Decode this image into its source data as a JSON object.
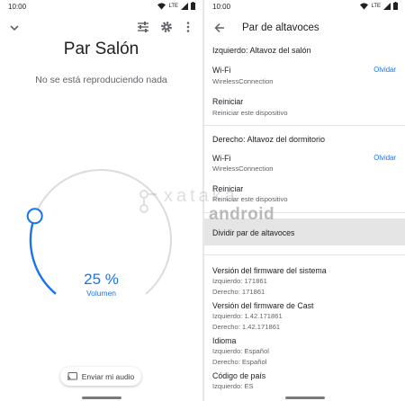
{
  "left": {
    "status": {
      "time": "10:00",
      "network": "LTE"
    },
    "title": "Par Salón",
    "subtitle": "No se está reproduciendo nada",
    "icons": [
      "chevron-down-icon",
      "tune-icon",
      "gear-icon",
      "more-vert-icon"
    ],
    "volume": {
      "percent_label": "25 %",
      "label": "Volumen",
      "level": 0.25
    },
    "cast_button": {
      "label": "Enviar mi audio",
      "icon": "cast-icon"
    }
  },
  "right": {
    "status": {
      "time": "10:00",
      "network": "LTE"
    },
    "title": "Par de altavoces",
    "left_section": "Izquierdo: Altavoz del salón",
    "left_wifi": {
      "title": "Wi-Fi",
      "sub": "WirelessConnection",
      "action": "Olvidar"
    },
    "left_restart": {
      "title": "Reiniciar",
      "sub": "Reiniciar este dispositivo"
    },
    "right_section": "Derecho: Altavoz del dormitorio",
    "right_wifi": {
      "title": "Wi-Fi",
      "sub": "WirelessConnection",
      "action": "Olvidar"
    },
    "right_restart": {
      "title": "Reiniciar",
      "sub": "Reiniciar este dispositivo"
    },
    "split": "Dividir par de altavoces",
    "firmware": {
      "title": "Versión del firmware del sistema",
      "left": "Izquierdo: 171861",
      "right": "Derecho: 171861"
    },
    "cast_firmware": {
      "title": "Versión del firmware de Cast",
      "left": "Izquierdo: 1.42.171861",
      "right": "Derecho: 1.42.171861"
    },
    "language": {
      "title": "Idioma",
      "left": "Izquierdo: Español",
      "right": "Derecho: Español"
    },
    "country": {
      "title": "Código de país",
      "left": "Izquierdo: ES"
    }
  },
  "watermark": {
    "line1": "xataka",
    "line2": "android"
  },
  "colors": {
    "accent": "#1a73e8",
    "track": "#dadce0"
  }
}
